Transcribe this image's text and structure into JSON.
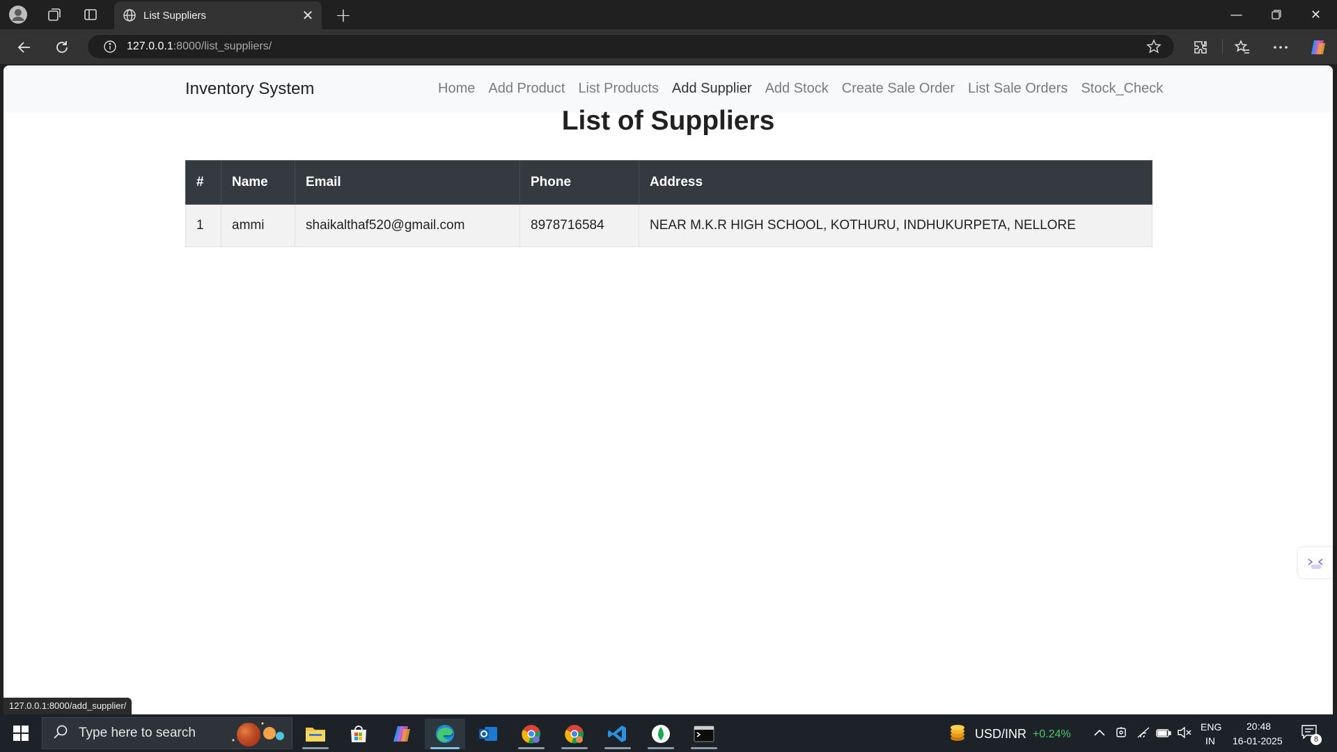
{
  "browser": {
    "tab_title": "List Suppliers",
    "url_host": "127.0.0.1",
    "url_rest": ":8000/list_suppliers/",
    "status_url": "127.0.0.1:8000/add_supplier/"
  },
  "navbar": {
    "brand": "Inventory System",
    "links": [
      {
        "label": "Home"
      },
      {
        "label": "Add Product"
      },
      {
        "label": "List Products"
      },
      {
        "label": "Add Supplier"
      },
      {
        "label": "Add Stock"
      },
      {
        "label": "Create Sale Order"
      },
      {
        "label": "List Sale Orders"
      },
      {
        "label": "Stock_Check"
      }
    ]
  },
  "page": {
    "title": "List of Suppliers"
  },
  "table": {
    "headers": [
      "#",
      "Name",
      "Email",
      "Phone",
      "Address"
    ],
    "rows": [
      [
        "1",
        "ammi",
        "shaikalthaf520@gmail.com",
        "8978716584",
        "NEAR M.K.R HIGH SCHOOL, KOTHURU, INDHUKURPETA, NELLORE"
      ]
    ]
  },
  "taskbar": {
    "search_placeholder": "Type here to search",
    "ticker_label": "USD/INR",
    "ticker_change": "+0.24%",
    "lang_top": "ENG",
    "lang_bottom": "IN",
    "time": "20:48",
    "date": "16-01-2025",
    "notification_count": "8"
  },
  "colors": {
    "table_header_bg": "#343a40",
    "navbar_bg": "#f8f9fa",
    "ticker_positive": "#4ec96b"
  }
}
